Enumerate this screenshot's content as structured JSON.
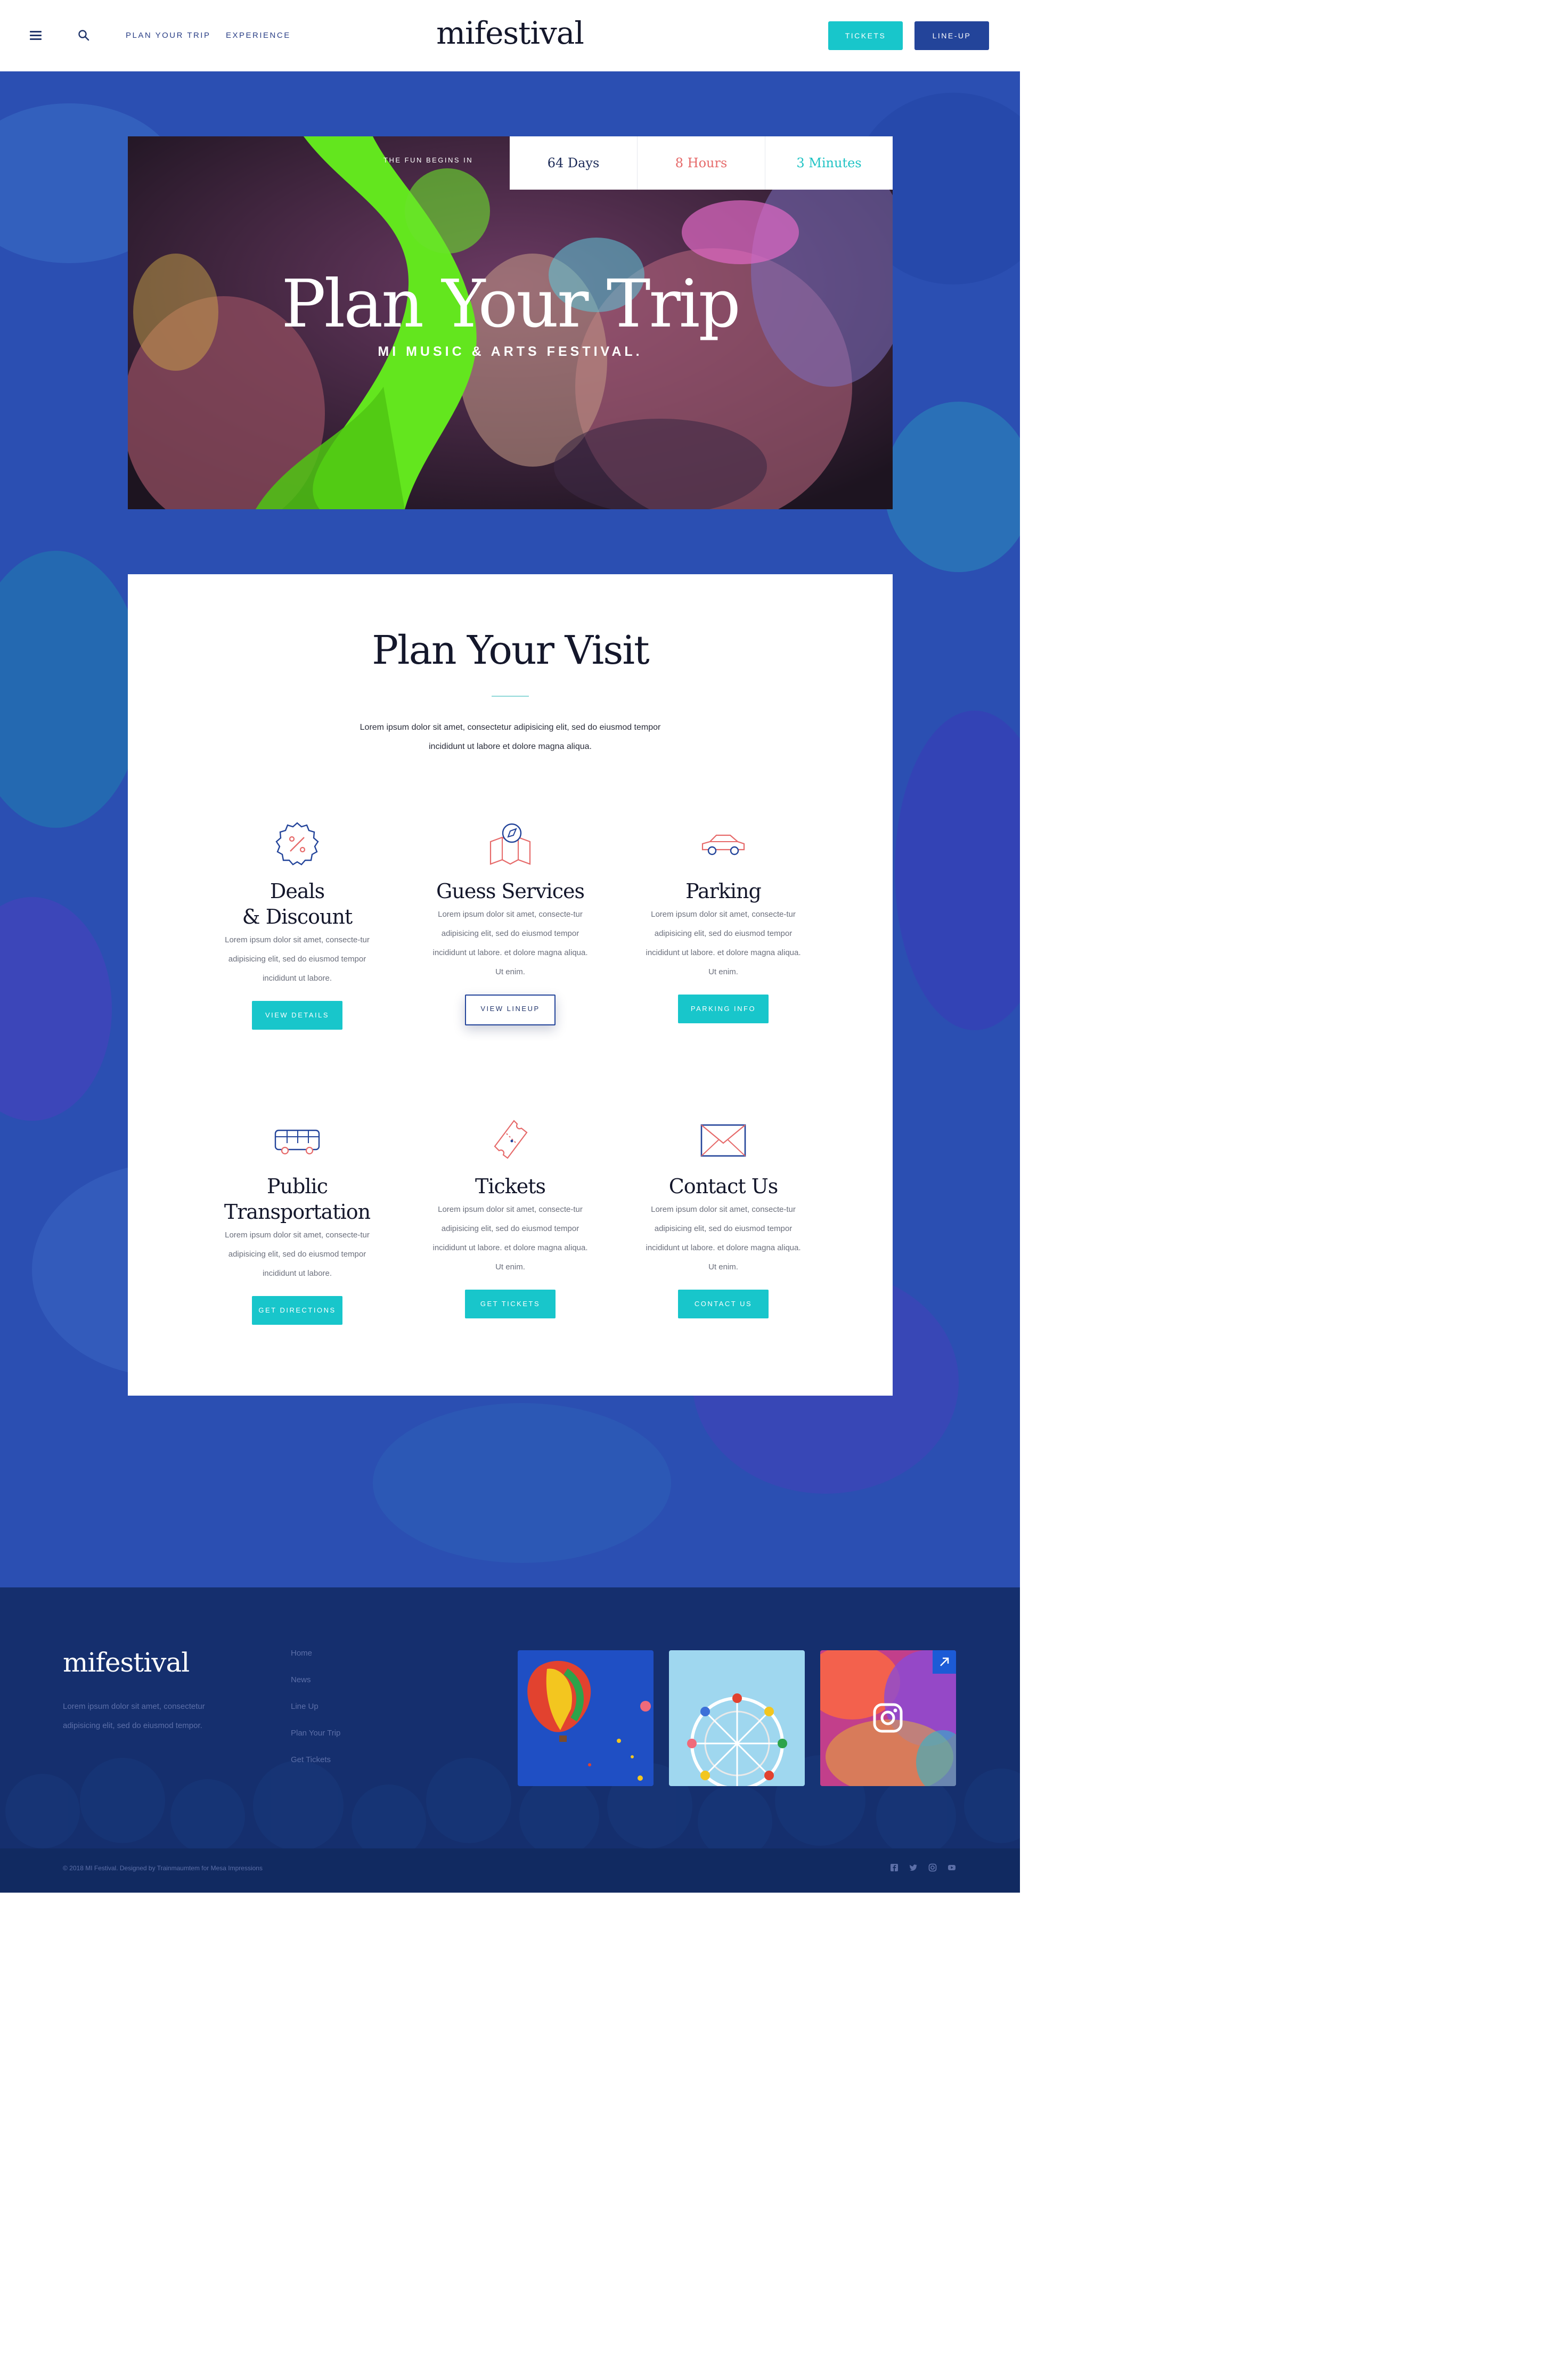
{
  "header": {
    "logo": "mifestival",
    "nav": [
      "PLAN YOUR TRIP",
      "EXPERIENCE"
    ],
    "tickets_label": "TICKETS",
    "lineup_label": "LINE-UP"
  },
  "hero": {
    "countdown_label": "THE FUN BEGINS IN",
    "countdown": {
      "days": "64 Days",
      "hours": "8 Hours",
      "minutes": "3 Minutes"
    },
    "title": "Plan Your Trip",
    "subtitle": "MI MUSIC & ARTS FESTIVAL."
  },
  "visit": {
    "title": "Plan Your Visit",
    "intro": "Lorem ipsum dolor sit amet, consectetur adipisicing elit, sed do eiusmod tempor incididunt ut labore et dolore magna aliqua.",
    "features": [
      {
        "icon": "discount-badge-icon",
        "title": "Deals\n& Discount",
        "desc": "Lorem ipsum dolor sit amet, consecte-tur adipisicing elit, sed do eiusmod tempor incididunt ut labore.",
        "button": "VIEW DETAILS"
      },
      {
        "icon": "map-compass-icon",
        "title": "Guess Services",
        "desc": "Lorem ipsum dolor sit amet, consecte-tur adipisicing elit, sed do eiusmod tempor incididunt ut labore. et dolore magna aliqua. Ut enim.",
        "button": "VIEW LINEUP"
      },
      {
        "icon": "car-icon",
        "title": "Parking",
        "desc": "Lorem ipsum dolor sit amet, consecte-tur adipisicing elit, sed do eiusmod tempor incididunt ut labore. et dolore magna aliqua. Ut enim.",
        "button": "PARKING INFO"
      },
      {
        "icon": "bus-icon",
        "title": "Public\nTransportation",
        "desc": "Lorem ipsum dolor sit amet, consecte-tur adipisicing elit, sed do eiusmod tempor incididunt ut labore.",
        "button": "GET DIRECTIONS"
      },
      {
        "icon": "ticket-icon",
        "title": "Tickets",
        "desc": "Lorem ipsum dolor sit amet, consecte-tur adipisicing elit, sed do eiusmod tempor incididunt ut labore. et dolore magna aliqua. Ut enim.",
        "button": "GET TICKETS"
      },
      {
        "icon": "envelope-icon",
        "title": "Contact Us",
        "desc": "Lorem ipsum dolor sit amet, consecte-tur adipisicing elit, sed do eiusmod tempor incididunt ut labore. et dolore magna aliqua. Ut enim.",
        "button": "CONTACT US"
      }
    ]
  },
  "footer": {
    "logo": "mifestival",
    "about": "Lorem ipsum dolor sit amet, consectetur adipisicing elit, sed do eiusmod tempor.",
    "links": [
      "Home",
      "News",
      "Line Up",
      "Plan Your Trip",
      "Get Tickets"
    ],
    "copyright": "© 2018 MI Festival. Designed by Trainmaumtem for Mesa Impressions",
    "social": [
      "facebook-icon",
      "twitter-icon",
      "instagram-icon",
      "youtube-icon"
    ]
  },
  "colors": {
    "accent": "#18c6cb",
    "navy": "#23449a",
    "hero_blue": "#2b4fb2",
    "footer": "#152f6e"
  }
}
